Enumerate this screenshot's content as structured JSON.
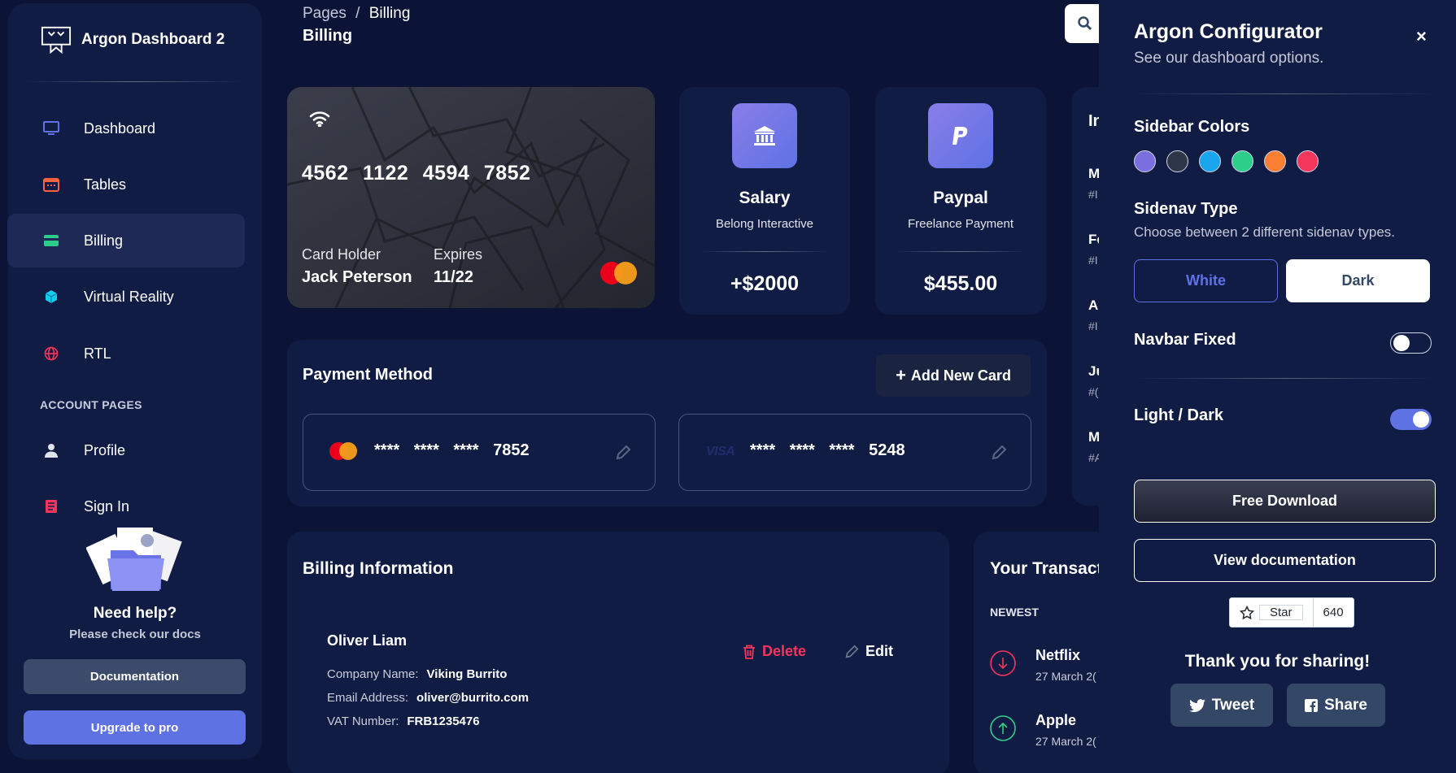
{
  "sidebar": {
    "brand": "Argon Dashboard 2",
    "items": [
      {
        "label": "Dashboard"
      },
      {
        "label": "Tables"
      },
      {
        "label": "Billing"
      },
      {
        "label": "Virtual Reality"
      },
      {
        "label": "RTL"
      }
    ],
    "section_label": "ACCOUNT PAGES",
    "account_items": [
      {
        "label": "Profile"
      },
      {
        "label": "Sign In"
      }
    ],
    "help_title": "Need help?",
    "help_subtitle": "Please check our docs",
    "documentation_label": "Documentation",
    "upgrade_label": "Upgrade to pro"
  },
  "header": {
    "breadcrumb_root": "Pages",
    "breadcrumb_sep": "/",
    "breadcrumb_current": "Billing",
    "title": "Billing"
  },
  "credit_card": {
    "number": "4562 1122 4594 7852",
    "holder_label": "Card Holder",
    "holder": "Jack Peterson",
    "expires_label": "Expires",
    "expires": "11/22"
  },
  "stats": [
    {
      "title": "Salary",
      "subtitle": "Belong Interactive",
      "value": "+$2000",
      "icon": "bank-icon"
    },
    {
      "title": "Paypal",
      "subtitle": "Freelance Payment",
      "value": "$455.00",
      "icon": "paypal-icon"
    }
  ],
  "payment": {
    "title": "Payment Method",
    "add_label": "Add New Card",
    "cards": [
      {
        "brand": "mastercard",
        "masked": "**** **** ****",
        "last4": "7852"
      },
      {
        "brand": "VISA",
        "masked": "**** **** ****",
        "last4": "5248"
      }
    ]
  },
  "invoices_partial": {
    "title": "In",
    "rows": [
      {
        "a": "M",
        "b": "#I"
      },
      {
        "a": "Fe",
        "b": "#I"
      },
      {
        "a": "A",
        "b": "#I"
      },
      {
        "a": "Ju",
        "b": "#("
      },
      {
        "a": "M",
        "b": "#A"
      }
    ]
  },
  "billing": {
    "title": "Billing Information",
    "name": "Oliver Liam",
    "company_label": "Company Name:",
    "company": "Viking Burrito",
    "email_label": "Email Address:",
    "email": "oliver@burrito.com",
    "vat_label": "VAT Number:",
    "vat": "FRB1235476",
    "delete_label": "Delete",
    "edit_label": "Edit"
  },
  "transactions": {
    "title": "Your Transact",
    "newest_label": "NEWEST",
    "items": [
      {
        "name": "Netflix",
        "date": "27 March 2(",
        "direction": "down"
      },
      {
        "name": "Apple",
        "date": "27 March 2(",
        "direction": "up"
      }
    ]
  },
  "configurator": {
    "title": "Argon Configurator",
    "subtitle": "See our dashboard options.",
    "close": "×",
    "sidebar_colors_label": "Sidebar Colors",
    "colors": [
      "#7b6fe0",
      "#2d3748",
      "#1aa5ef",
      "#2dce89",
      "#fb7f32",
      "#f5365c"
    ],
    "sidenav_type_label": "Sidenav Type",
    "sidenav_desc": "Choose between 2 different sidenav types.",
    "white_label": "White",
    "dark_label": "Dark",
    "navbar_fixed_label": "Navbar Fixed",
    "navbar_fixed": false,
    "light_dark_label": "Light / Dark",
    "dark_mode": true,
    "free_download_label": "Free Download",
    "view_docs_label": "View documentation",
    "star_label": "Star",
    "star_count": "640",
    "thanks_label": "Thank you for sharing!",
    "tweet_label": "Tweet",
    "share_label": "Share"
  }
}
